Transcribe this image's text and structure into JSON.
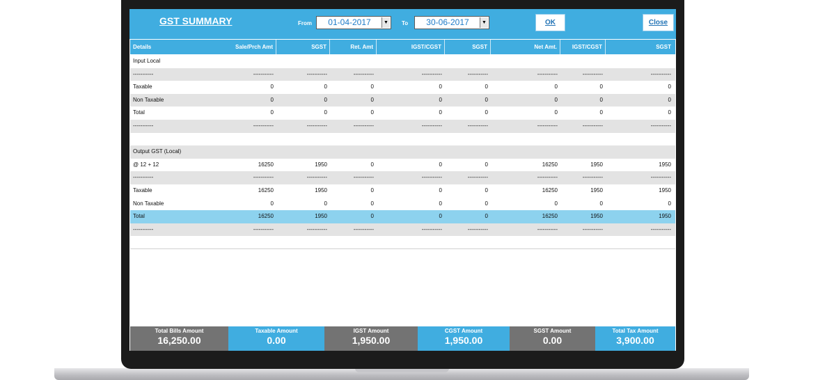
{
  "header": {
    "title": "GST SUMMARY",
    "from_label": "From",
    "from_date": "01-04-2017",
    "to_label": "To",
    "to_date": "30-06-2017",
    "ok_label": "OK",
    "close_label": "Close"
  },
  "columns": [
    "Details",
    "Sale/Prch Amt",
    "SGST",
    "Ret. Amt",
    "IGST/CGST",
    "SGST",
    "Net Amt.",
    "IGST/CGST",
    "SGST"
  ],
  "rows": [
    {
      "label": "Input Local",
      "values": [
        "",
        "",
        "",
        "",
        "",
        "",
        "",
        ""
      ]
    },
    {
      "label": "-----------",
      "values": [
        "-----------",
        "-----------",
        "-----------",
        "-----------",
        "-----------",
        "-----------",
        "-----------",
        "-----------"
      ]
    },
    {
      "label": "Taxable",
      "values": [
        "0",
        "0",
        "0",
        "0",
        "0",
        "0",
        "0",
        "0"
      ]
    },
    {
      "label": "Non Taxable",
      "values": [
        "0",
        "0",
        "0",
        "0",
        "0",
        "0",
        "0",
        "0"
      ]
    },
    {
      "label": "Total",
      "values": [
        "0",
        "0",
        "0",
        "0",
        "0",
        "0",
        "0",
        "0"
      ]
    },
    {
      "label": "-----------",
      "values": [
        "-----------",
        "-----------",
        "-----------",
        "-----------",
        "-----------",
        "-----------",
        "-----------",
        "-----------"
      ]
    },
    {
      "label": "",
      "values": [
        "",
        "",
        "",
        "",
        "",
        "",
        "",
        ""
      ]
    },
    {
      "label": "Output GST (Local)",
      "values": [
        "",
        "",
        "",
        "",
        "",
        "",
        "",
        ""
      ]
    },
    {
      "label": "@ 12 + 12",
      "values": [
        "16250",
        "1950",
        "0",
        "0",
        "0",
        "16250",
        "1950",
        "1950"
      ]
    },
    {
      "label": "-----------",
      "values": [
        "-----------",
        "-----------",
        "-----------",
        "-----------",
        "-----------",
        "-----------",
        "-----------",
        "-----------"
      ]
    },
    {
      "label": "Taxable",
      "values": [
        "16250",
        "1950",
        "0",
        "0",
        "0",
        "16250",
        "1950",
        "1950"
      ]
    },
    {
      "label": "Non Taxable",
      "values": [
        "0",
        "0",
        "0",
        "0",
        "0",
        "0",
        "0",
        "0"
      ]
    },
    {
      "label": "Total",
      "values": [
        "16250",
        "1950",
        "0",
        "0",
        "0",
        "16250",
        "1950",
        "1950"
      ]
    },
    {
      "label": "-----------",
      "values": [
        "-----------",
        "-----------",
        "-----------",
        "-----------",
        "-----------",
        "-----------",
        "-----------",
        "-----------"
      ]
    }
  ],
  "footer": [
    {
      "title": "Total Bills Amount",
      "value": "16,250.00"
    },
    {
      "title": "Taxable Amount",
      "value": "0.00"
    },
    {
      "title": "IGST Amount",
      "value": "1,950.00"
    },
    {
      "title": "CGST Amount",
      "value": "1,950.00"
    },
    {
      "title": "SGST Amount",
      "value": "0.00"
    },
    {
      "title": "Total Tax Amount",
      "value": "3,900.00"
    }
  ],
  "colors": {
    "accent": "#40ade0",
    "selected_row": "#8dd2ee",
    "footer_gray": "#737373"
  }
}
